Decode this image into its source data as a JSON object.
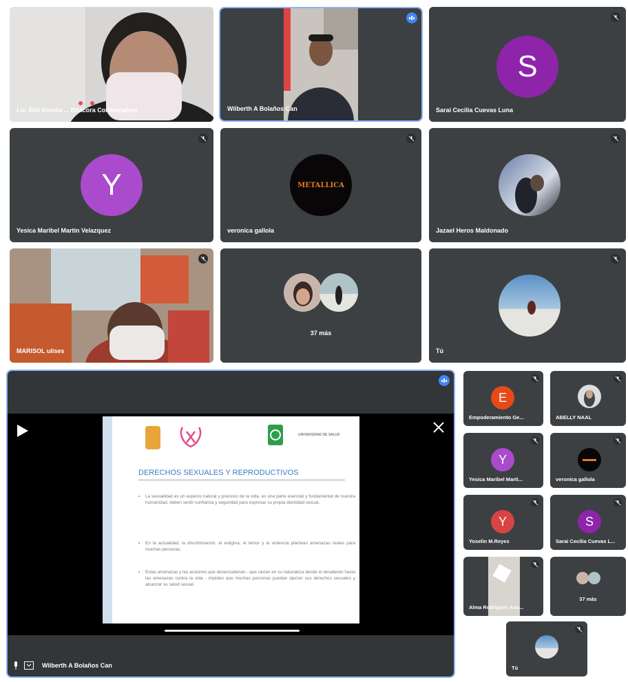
{
  "participants": [
    {
      "name": "Lic. Elsi Arcelia ...  Bitácora Colaboradora"
    },
    {
      "name": "Wilberth A Bolaños Can"
    },
    {
      "name": "Sarai Cecilia Cuevas Luna",
      "initial": "S"
    },
    {
      "name": "Yesica Maribel Martin Velazquez",
      "initial": "Y"
    },
    {
      "name": "veronica gallola",
      "avatar_text": "METALLICA"
    },
    {
      "name": "Jazael Heros Maldonado"
    },
    {
      "name": "MARISOL ulises"
    },
    {
      "name": "37 más"
    },
    {
      "name": "Tú"
    }
  ],
  "presenter": {
    "name": "Wilberth A Bolaños Can"
  },
  "slide": {
    "title": "DERECHOS SEXUALES Y REPRODUCTIVOS",
    "logo_right_text": "UNIVERSIDAD DE SALUD",
    "bullets": [
      "La sexualidad es un aspecto natural y precioso de la vida, es una parte esencial y fundamental de nuestra humanidad, deben sentir confianza y seguridad para expresar su propia identidad sexual.",
      "En la actualidad, la discriminación, el estigma, el temor y la violencia plantean amenazas reales para muchas personas.",
      "Estas amenazas y las acciones que desencadenan - que varían en su naturaleza desde el desaliento hasta las amenazas contra la vida - impiden que muchas personas puedan ejercer sus derechos sexuales y alcanzar su salud sexual."
    ]
  },
  "sidebar": [
    {
      "name": "Empoderamiento Ge...",
      "initial": "E"
    },
    {
      "name": "ABELLY NAAL"
    },
    {
      "name": "Yesica Maribel Marti...",
      "initial": "Y"
    },
    {
      "name": "veronica gallola"
    },
    {
      "name": "Yoselin M.Reyes",
      "initial": "Y"
    },
    {
      "name": "Sarai Cecilia Cuevas L...",
      "initial": "S"
    },
    {
      "name": "Alma Rodríguez Ana..."
    },
    {
      "name": "37 más"
    },
    {
      "name": "Tú"
    }
  ],
  "colors": {
    "tile": "#3c4043",
    "purple": "#8e24aa",
    "orange": "#e64a19",
    "active_border": "#8ab4f8"
  }
}
